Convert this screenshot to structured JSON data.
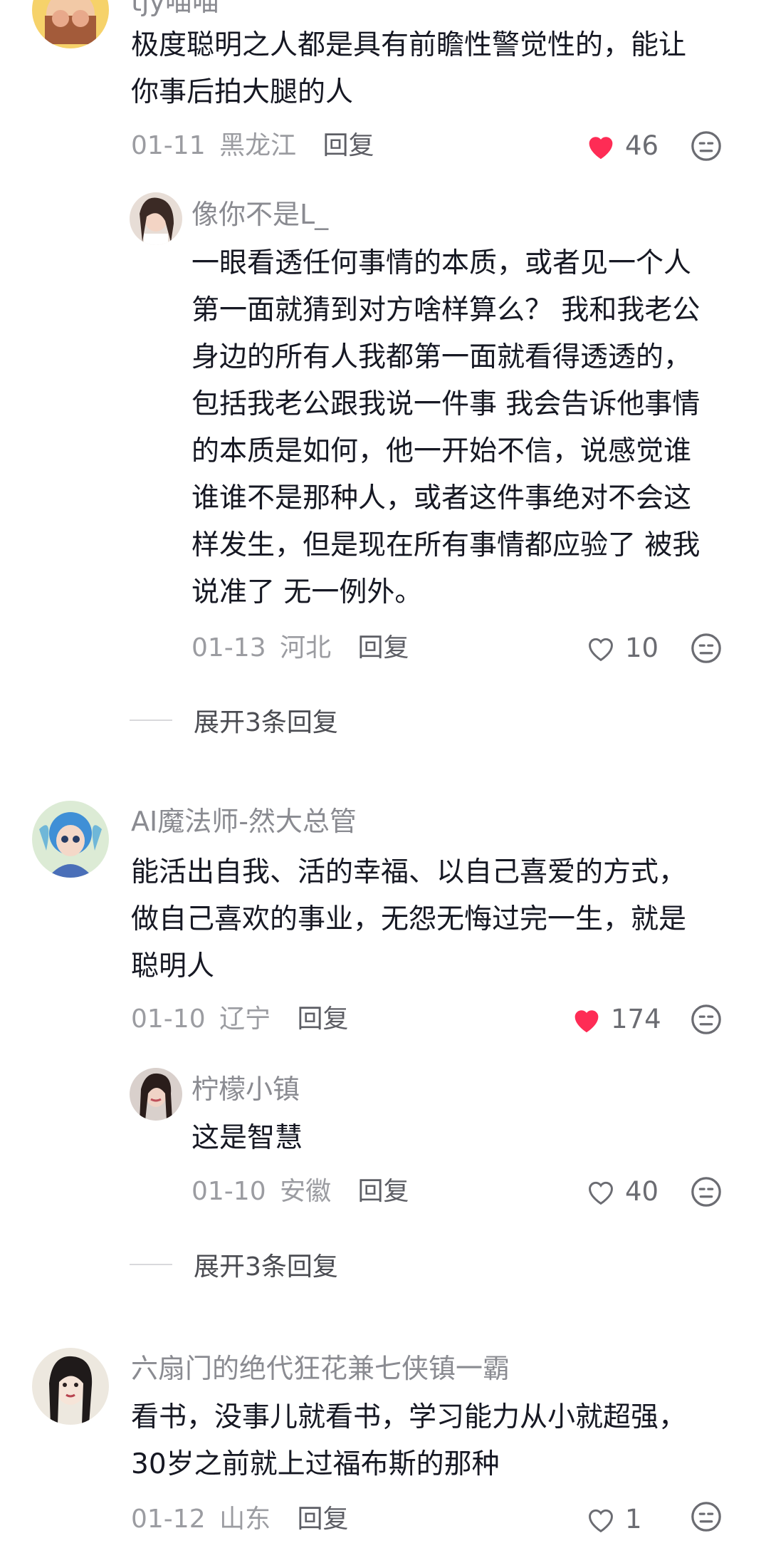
{
  "comments": [
    {
      "user": "tjy喵喵",
      "lines": [
        "极度聪明之人都是具有前瞻性警觉性的，能让",
        "你事后拍大腿的人"
      ],
      "date": "01-11",
      "location": "黑龙江",
      "reply_label": "回复",
      "likes": "46",
      "liked": true,
      "replies": [
        {
          "user": "像你不是L_",
          "lines": [
            "一眼看透任何事情的本质，或者见一个人",
            "第一面就猜到对方啥样算么？ 我和我老公",
            "身边的所有人我都第一面就看得透透的，",
            "包括我老公跟我说一件事 我会告诉他事情",
            "的本质是如何，他一开始不信，说感觉谁",
            "谁谁不是那种人，或者这件事绝对不会这",
            "样发生，但是现在所有事情都应验了 被我",
            "说准了 无一例外。"
          ],
          "date": "01-13",
          "location": "河北",
          "reply_label": "回复",
          "likes": "10",
          "liked": false
        }
      ],
      "expand_label": "展开3条回复"
    },
    {
      "user": "AI魔法师-然大总管",
      "lines": [
        "能活出自我、活的幸福、以自己喜爱的方式，",
        "做自己喜欢的事业，无怨无悔过完一生，就是",
        "聪明人"
      ],
      "date": "01-10",
      "location": "辽宁",
      "reply_label": "回复",
      "likes": "174",
      "liked": true,
      "replies": [
        {
          "user": "柠檬小镇",
          "lines": [
            "这是智慧"
          ],
          "date": "01-10",
          "location": "安徽",
          "reply_label": "回复",
          "likes": "40",
          "liked": false
        }
      ],
      "expand_label": "展开3条回复"
    },
    {
      "user": "六扇门的绝代狂花兼七侠镇一霸",
      "lines": [
        "看书，没事儿就看书，学习能力从小就超强，",
        "30岁之前就上过福布斯的那种"
      ],
      "date": "01-12",
      "location": "山东",
      "reply_label": "回复",
      "likes": "1",
      "liked": false
    }
  ],
  "colors": {
    "heart_liked": "#fe2c55",
    "text_primary": "#161823",
    "text_secondary": "#8a8b91"
  },
  "icons": {
    "like": "heart-icon",
    "dislike": "dislike-face-icon"
  }
}
